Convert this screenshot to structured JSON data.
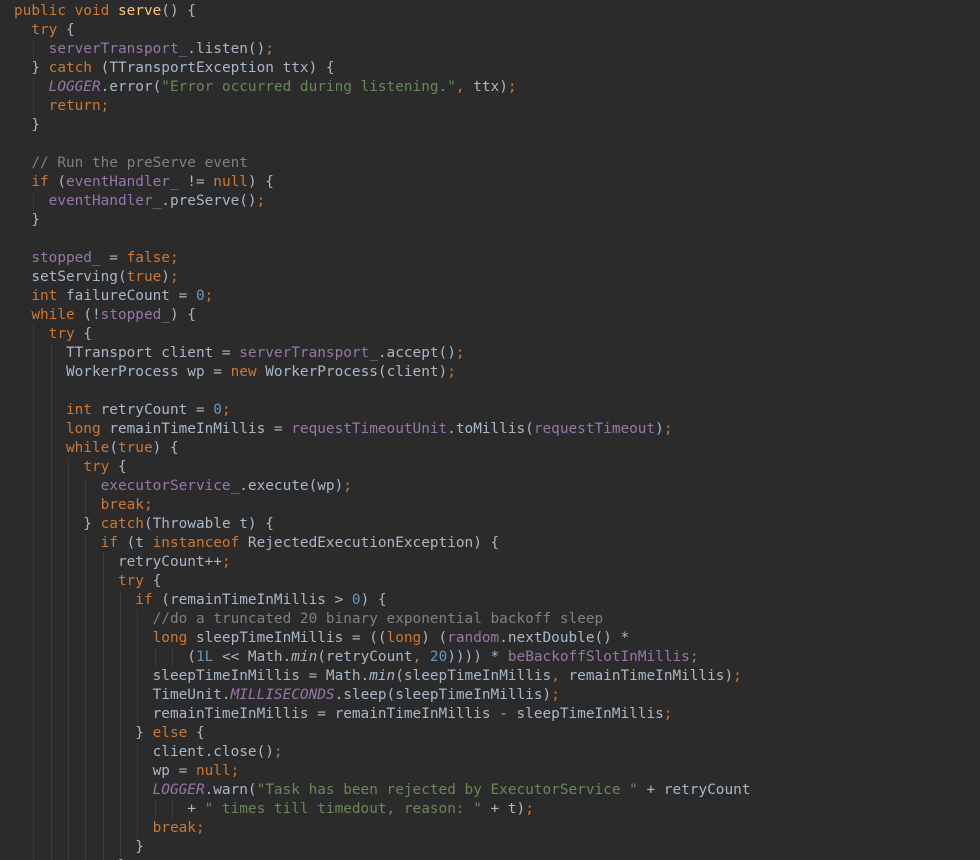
{
  "editor": {
    "colors": {
      "background": "#2b2b2b",
      "plain": "#a9b7c6",
      "keyword": "#cc7832",
      "method_decl": "#ffc66d",
      "field": "#9876aa",
      "string": "#6a8759",
      "number": "#6897bb",
      "comment": "#808080",
      "indent_guide": "#3b3b3b"
    },
    "lines": [
      [
        [
          "kw",
          "public void "
        ],
        [
          "fn",
          "serve"
        ],
        [
          "pln",
          "() {"
        ]
      ],
      [
        [
          "pln",
          "  "
        ],
        [
          "kw",
          "try"
        ],
        [
          "pln",
          " {"
        ]
      ],
      [
        [
          "pln",
          "    "
        ],
        [
          "fld",
          "serverTransport_"
        ],
        [
          "pln",
          ".listen()"
        ],
        [
          "kw",
          ";"
        ]
      ],
      [
        [
          "pln",
          "  } "
        ],
        [
          "kw",
          "catch"
        ],
        [
          "pln",
          " (TTransportException ttx) {"
        ]
      ],
      [
        [
          "pln",
          "    "
        ],
        [
          "fldi",
          "LOGGER"
        ],
        [
          "pln",
          ".error("
        ],
        [
          "str",
          "\"Error occurred during listening.\""
        ],
        [
          "kw",
          ", "
        ],
        [
          "pln",
          "ttx)"
        ],
        [
          "kw",
          ";"
        ]
      ],
      [
        [
          "pln",
          "    "
        ],
        [
          "kw",
          "return;"
        ]
      ],
      [
        [
          "pln",
          "  }"
        ]
      ],
      [],
      [
        [
          "pln",
          "  "
        ],
        [
          "cmt",
          "// Run the preServe event"
        ]
      ],
      [
        [
          "pln",
          "  "
        ],
        [
          "kw",
          "if"
        ],
        [
          "pln",
          " ("
        ],
        [
          "fld",
          "eventHandler_"
        ],
        [
          "pln",
          " != "
        ],
        [
          "kw",
          "null"
        ],
        [
          "pln",
          ") {"
        ]
      ],
      [
        [
          "pln",
          "    "
        ],
        [
          "fld",
          "eventHandler_"
        ],
        [
          "pln",
          ".preServe()"
        ],
        [
          "kw",
          ";"
        ]
      ],
      [
        [
          "pln",
          "  }"
        ]
      ],
      [],
      [
        [
          "pln",
          "  "
        ],
        [
          "fld",
          "stopped_"
        ],
        [
          "pln",
          " = "
        ],
        [
          "kw",
          "false;"
        ]
      ],
      [
        [
          "pln",
          "  setServing("
        ],
        [
          "kw",
          "true"
        ],
        [
          "pln",
          ")"
        ],
        [
          "kw",
          ";"
        ]
      ],
      [
        [
          "pln",
          "  "
        ],
        [
          "kw",
          "int"
        ],
        [
          "pln",
          " failureCount = "
        ],
        [
          "num",
          "0"
        ],
        [
          "kw",
          ";"
        ]
      ],
      [
        [
          "pln",
          "  "
        ],
        [
          "kw",
          "while"
        ],
        [
          "pln",
          " (!"
        ],
        [
          "fld",
          "stopped_"
        ],
        [
          "pln",
          ") {"
        ]
      ],
      [
        [
          "pln",
          "    "
        ],
        [
          "kw",
          "try"
        ],
        [
          "pln",
          " {"
        ]
      ],
      [
        [
          "pln",
          "      TTransport client = "
        ],
        [
          "fld",
          "serverTransport_"
        ],
        [
          "pln",
          ".accept()"
        ],
        [
          "kw",
          ";"
        ]
      ],
      [
        [
          "pln",
          "      WorkerProcess wp = "
        ],
        [
          "kw",
          "new"
        ],
        [
          "pln",
          " WorkerProcess(client)"
        ],
        [
          "kw",
          ";"
        ]
      ],
      [],
      [
        [
          "pln",
          "      "
        ],
        [
          "kw",
          "int"
        ],
        [
          "pln",
          " retryCount = "
        ],
        [
          "num",
          "0"
        ],
        [
          "kw",
          ";"
        ]
      ],
      [
        [
          "pln",
          "      "
        ],
        [
          "kw",
          "long"
        ],
        [
          "pln",
          " remainTimeInMillis = "
        ],
        [
          "fld",
          "requestTimeoutUnit"
        ],
        [
          "pln",
          ".toMillis("
        ],
        [
          "fld",
          "requestTimeout"
        ],
        [
          "pln",
          ")"
        ],
        [
          "kw",
          ";"
        ]
      ],
      [
        [
          "pln",
          "      "
        ],
        [
          "kw",
          "while"
        ],
        [
          "pln",
          "("
        ],
        [
          "kw",
          "true"
        ],
        [
          "pln",
          ") {"
        ]
      ],
      [
        [
          "pln",
          "        "
        ],
        [
          "kw",
          "try"
        ],
        [
          "pln",
          " {"
        ]
      ],
      [
        [
          "pln",
          "          "
        ],
        [
          "fld",
          "executorService_"
        ],
        [
          "pln",
          ".execute(wp)"
        ],
        [
          "kw",
          ";"
        ]
      ],
      [
        [
          "pln",
          "          "
        ],
        [
          "kw",
          "break;"
        ]
      ],
      [
        [
          "pln",
          "        } "
        ],
        [
          "kw",
          "catch"
        ],
        [
          "pln",
          "(Throwable t) {"
        ]
      ],
      [
        [
          "pln",
          "          "
        ],
        [
          "kw",
          "if"
        ],
        [
          "pln",
          " (t "
        ],
        [
          "kw",
          "instanceof"
        ],
        [
          "pln",
          " RejectedExecutionException) {"
        ]
      ],
      [
        [
          "pln",
          "            retryCount++"
        ],
        [
          "kw",
          ";"
        ]
      ],
      [
        [
          "pln",
          "            "
        ],
        [
          "kw",
          "try"
        ],
        [
          "pln",
          " {"
        ]
      ],
      [
        [
          "pln",
          "              "
        ],
        [
          "kw",
          "if"
        ],
        [
          "pln",
          " (remainTimeInMillis > "
        ],
        [
          "num",
          "0"
        ],
        [
          "pln",
          ") {"
        ]
      ],
      [
        [
          "pln",
          "                "
        ],
        [
          "cmt",
          "//do a truncated 20 binary exponential backoff sleep"
        ]
      ],
      [
        [
          "pln",
          "                "
        ],
        [
          "kw",
          "long"
        ],
        [
          "pln",
          " sleepTimeInMillis = (("
        ],
        [
          "kw",
          "long"
        ],
        [
          "pln",
          ") ("
        ],
        [
          "fld",
          "random"
        ],
        [
          "pln",
          ".nextDouble() *"
        ]
      ],
      [
        [
          "pln",
          "                    ("
        ],
        [
          "num",
          "1L"
        ],
        [
          "pln",
          " << Math."
        ],
        [
          "it",
          "min"
        ],
        [
          "pln",
          "(retryCount"
        ],
        [
          "kw",
          ", "
        ],
        [
          "num",
          "20"
        ],
        [
          "pln",
          "))))"
        ],
        [
          "pln",
          " * "
        ],
        [
          "fld",
          "beBackoffSlotInMillis"
        ],
        [
          "kw",
          ";"
        ]
      ],
      [
        [
          "pln",
          "                sleepTimeInMillis = Math."
        ],
        [
          "it",
          "min"
        ],
        [
          "pln",
          "(sleepTimeInMillis"
        ],
        [
          "kw",
          ", "
        ],
        [
          "pln",
          "remainTimeInMillis)"
        ],
        [
          "kw",
          ";"
        ]
      ],
      [
        [
          "pln",
          "                TimeUnit."
        ],
        [
          "fldi",
          "MILLISECONDS"
        ],
        [
          "pln",
          ".sleep(sleepTimeInMillis)"
        ],
        [
          "kw",
          ";"
        ]
      ],
      [
        [
          "pln",
          "                remainTimeInMillis = remainTimeInMillis - sleepTimeInMillis"
        ],
        [
          "kw",
          ";"
        ]
      ],
      [
        [
          "pln",
          "              } "
        ],
        [
          "kw",
          "else"
        ],
        [
          "pln",
          " {"
        ]
      ],
      [
        [
          "pln",
          "                client.close()"
        ],
        [
          "kw",
          ";"
        ]
      ],
      [
        [
          "pln",
          "                wp = "
        ],
        [
          "kw",
          "null;"
        ]
      ],
      [
        [
          "pln",
          "                "
        ],
        [
          "fldi",
          "LOGGER"
        ],
        [
          "pln",
          ".warn("
        ],
        [
          "str",
          "\"Task has been rejected by ExecutorService \""
        ],
        [
          "pln",
          " + retryCount"
        ]
      ],
      [
        [
          "pln",
          "                    + "
        ],
        [
          "str",
          "\" times till timedout, reason: \""
        ],
        [
          "pln",
          " + t)"
        ],
        [
          "kw",
          ";"
        ]
      ],
      [
        [
          "pln",
          "                "
        ],
        [
          "kw",
          "break;"
        ]
      ],
      [
        [
          "pln",
          "              }"
        ]
      ],
      [
        [
          "pln",
          "            }"
        ]
      ]
    ]
  }
}
